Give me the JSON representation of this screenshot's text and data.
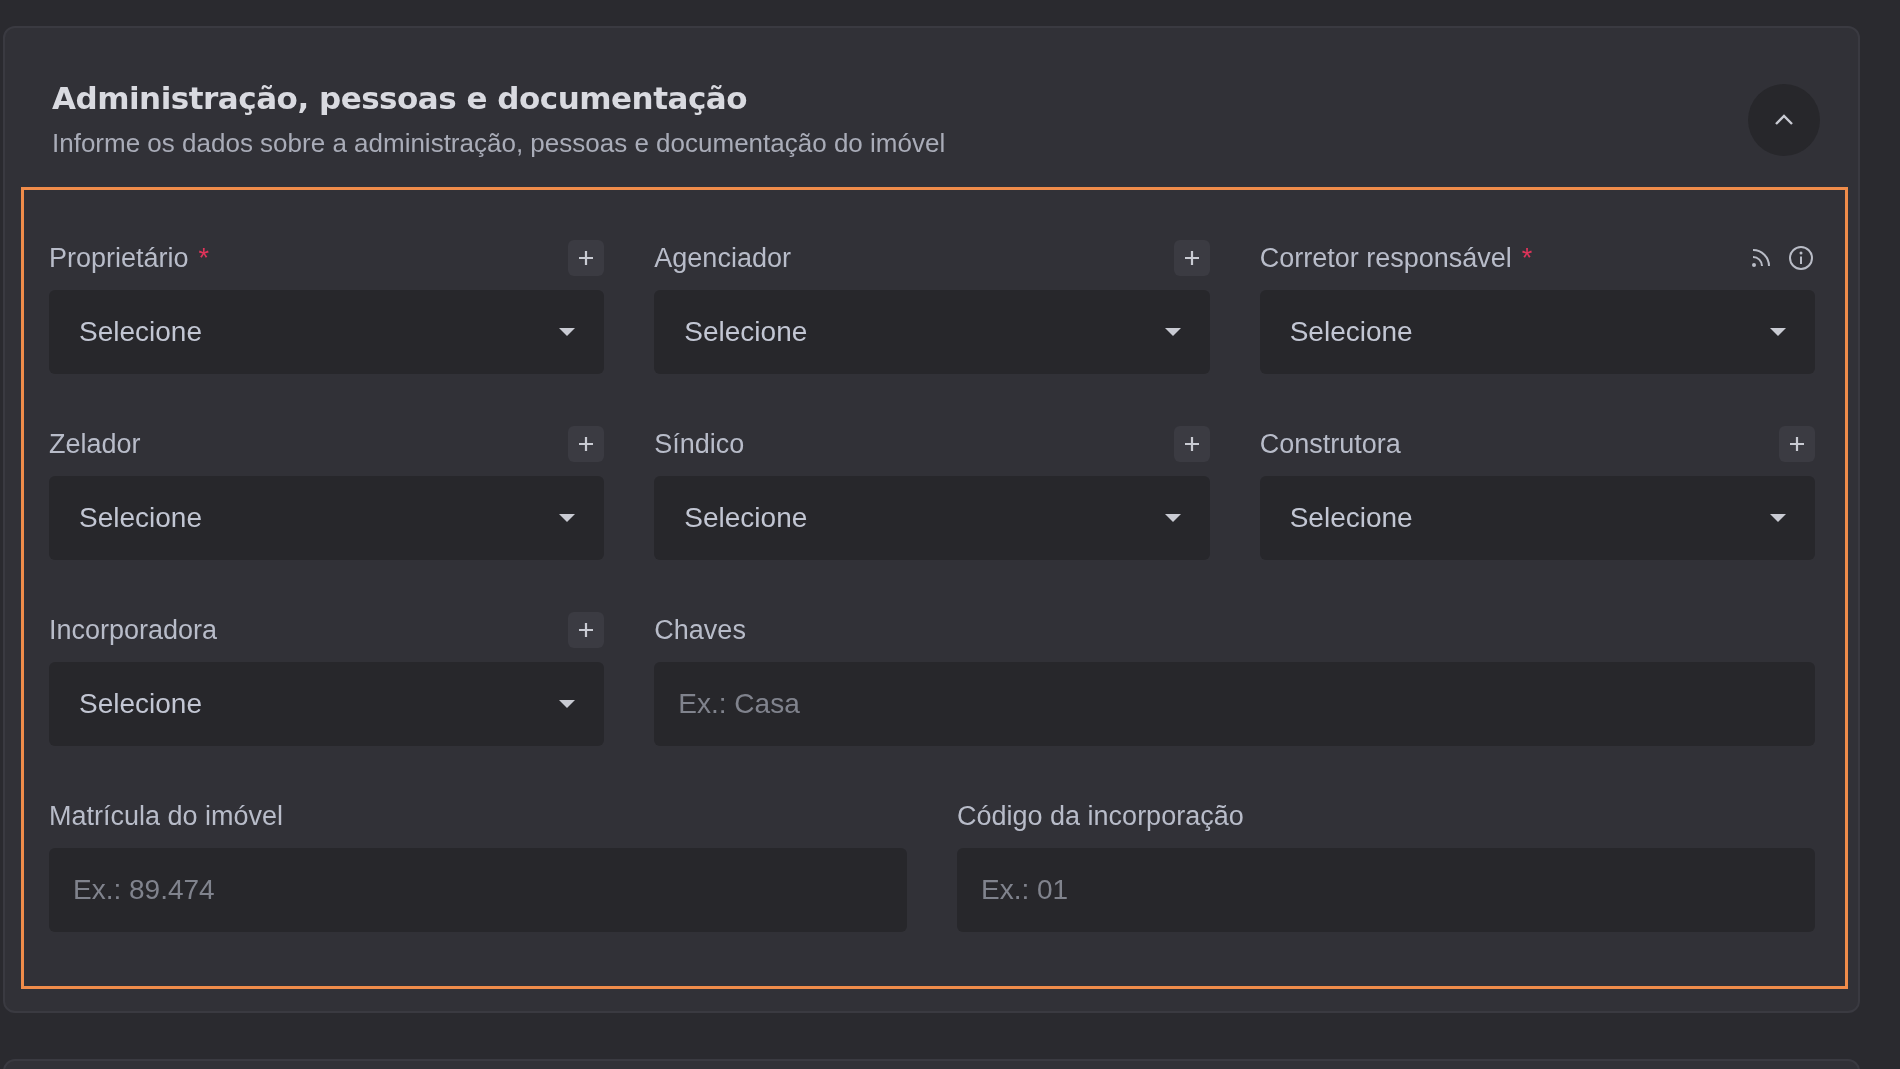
{
  "required_mark": "*",
  "section": {
    "title": "Administração, pessoas e documentação",
    "subtitle": "Informe os dados sobre a administração, pessoas e documentação do imóvel",
    "expanded": true
  },
  "rows": [
    [
      {
        "label": "Proprietário",
        "required": true,
        "kind": "select",
        "value": "Selecione",
        "actions": [
          {
            "kind": "add"
          }
        ]
      },
      {
        "label": "Agenciador",
        "required": false,
        "kind": "select",
        "value": "Selecione",
        "actions": [
          {
            "kind": "add"
          }
        ]
      },
      {
        "label": "Corretor responsável",
        "required": true,
        "kind": "select",
        "value": "Selecione",
        "actions": [
          {
            "kind": "feed"
          },
          {
            "kind": "info"
          }
        ]
      }
    ],
    [
      {
        "label": "Zelador",
        "required": false,
        "kind": "select",
        "value": "Selecione",
        "actions": [
          {
            "kind": "add"
          }
        ]
      },
      {
        "label": "Síndico",
        "required": false,
        "kind": "select",
        "value": "Selecione",
        "actions": [
          {
            "kind": "add"
          }
        ]
      },
      {
        "label": "Construtora",
        "required": false,
        "kind": "select",
        "value": "Selecione",
        "actions": [
          {
            "kind": "add"
          }
        ]
      }
    ],
    [
      {
        "label": "Incorporadora",
        "required": false,
        "kind": "select",
        "value": "Selecione",
        "actions": [
          {
            "kind": "add"
          }
        ]
      },
      {
        "label": "Chaves",
        "required": false,
        "kind": "text",
        "placeholder": "Ex.: Casa"
      }
    ],
    [
      {
        "label": "Matrícula do imóvel",
        "required": false,
        "kind": "text",
        "placeholder": "Ex.: 89.474"
      },
      {
        "label": "Código da incorporação",
        "required": false,
        "kind": "text",
        "placeholder": "Ex.: 01"
      }
    ]
  ]
}
